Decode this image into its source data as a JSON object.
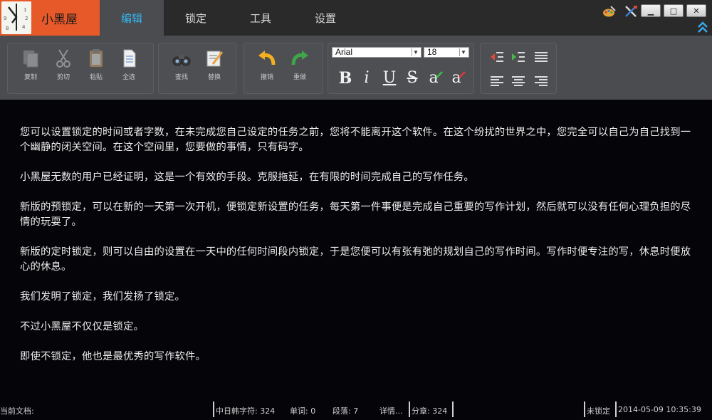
{
  "app": {
    "name": "小黑屋"
  },
  "menu": [
    {
      "label": "编辑",
      "active": true
    },
    {
      "label": "锁定",
      "active": false
    },
    {
      "label": "工具",
      "active": false
    },
    {
      "label": "设置",
      "active": false
    }
  ],
  "window_controls": {
    "minimize": "▁",
    "maximize": "□",
    "close": "✕"
  },
  "toolbar": {
    "copy": "复制",
    "cut": "剪切",
    "paste": "粘贴",
    "select_all": "全选",
    "find": "查找",
    "replace": "替换",
    "undo": "撤销",
    "redo": "重做",
    "font_family": "Arial",
    "font_size": "18",
    "bold": "B",
    "italic": "i",
    "underline": "U",
    "strike": "S",
    "font_color": "a",
    "highlight": "a"
  },
  "document": {
    "paragraphs": [
      "您可以设置锁定的时间或者字数，在未完成您自己设定的任务之前，您将不能离开这个软件。在这个纷扰的世界之中，您完全可以自己为自己找到一个幽静的闭关空间。在这个空间里，您要做的事情，只有码字。",
      "小黑屋无数的用户已经证明，这是一个有效的手段。克服拖延，在有限的时间完成自己的写作任务。",
      "新版的预锁定，可以在新的一天第一次开机，便锁定新设置的任务，每天第一件事便是完成自己重要的写作计划，然后就可以没有任何心理负担的尽情的玩耍了。",
      "新版的定时锁定，则可以自由的设置在一天中的任何时间段内锁定，于是您便可以有张有弛的规划自己的写作时间。写作时便专注的写，休息时便放心的休息。",
      "我们发明了锁定，我们发扬了锁定。",
      "不过小黑屋不仅仅是锁定。",
      "即使不锁定，他也是最优秀的写作软件。"
    ]
  },
  "status": {
    "current_doc": "当前文档:",
    "cjk_chars": "中日韩字符: 324",
    "words": "单词: 0",
    "paragraphs": "段落: 7",
    "details": "详情...",
    "chapter": "分章: 324",
    "lock_state": "未锁定",
    "datetime": "2014-05-09 10:35:39"
  },
  "colors": {
    "brand": "#e8592a",
    "active_tab_text": "#36b4ee",
    "toolbar": "#4a4c50",
    "document_bg": "#050509"
  }
}
